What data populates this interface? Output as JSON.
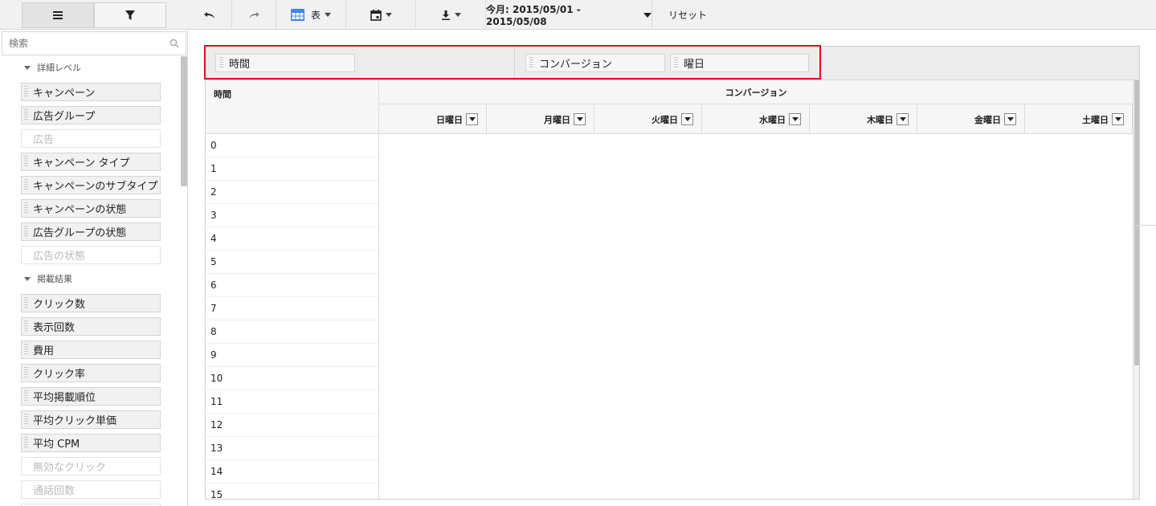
{
  "sidebar": {
    "search_placeholder": "検索",
    "sections": [
      {
        "label": "詳細レベル",
        "items": [
          {
            "label": "キャンペーン",
            "enabled": true
          },
          {
            "label": "広告グループ",
            "enabled": true
          },
          {
            "label": "広告",
            "enabled": false
          },
          {
            "label": "キャンペーン タイプ",
            "enabled": true
          },
          {
            "label": "キャンペーンのサブタイプ",
            "enabled": true
          },
          {
            "label": "キャンペーンの状態",
            "enabled": true
          },
          {
            "label": "広告グループの状態",
            "enabled": true
          },
          {
            "label": "広告の状態",
            "enabled": false
          }
        ]
      },
      {
        "label": "掲載結果",
        "items": [
          {
            "label": "クリック数",
            "enabled": true
          },
          {
            "label": "表示回数",
            "enabled": true
          },
          {
            "label": "費用",
            "enabled": true
          },
          {
            "label": "クリック率",
            "enabled": true
          },
          {
            "label": "平均掲載順位",
            "enabled": true
          },
          {
            "label": "平均クリック単価",
            "enabled": true
          },
          {
            "label": "平均 CPM",
            "enabled": true
          },
          {
            "label": "無効なクリック",
            "enabled": false
          },
          {
            "label": "通話回数",
            "enabled": false
          },
          {
            "label": "",
            "enabled": false
          }
        ]
      }
    ]
  },
  "toolbar": {
    "view_label": "表",
    "date_range": "今月: 2015/05/01 - 2015/05/08",
    "reset_label": "リセット"
  },
  "pivot": {
    "row_chip": "時間",
    "col_chips": [
      "コンバージョン",
      "曜日"
    ],
    "row_header": "時間",
    "metric_header": "コンバージョン",
    "days": [
      "日曜日",
      "月曜日",
      "火曜日",
      "水曜日",
      "木曜日",
      "金曜日",
      "土曜日"
    ],
    "rows": [
      "0",
      "1",
      "2",
      "3",
      "4",
      "5",
      "6",
      "7",
      "8",
      "9",
      "10",
      "11",
      "12",
      "13",
      "14",
      "15"
    ]
  },
  "colors": {
    "highlight": "#e0111b",
    "accent": "#4285f4"
  }
}
